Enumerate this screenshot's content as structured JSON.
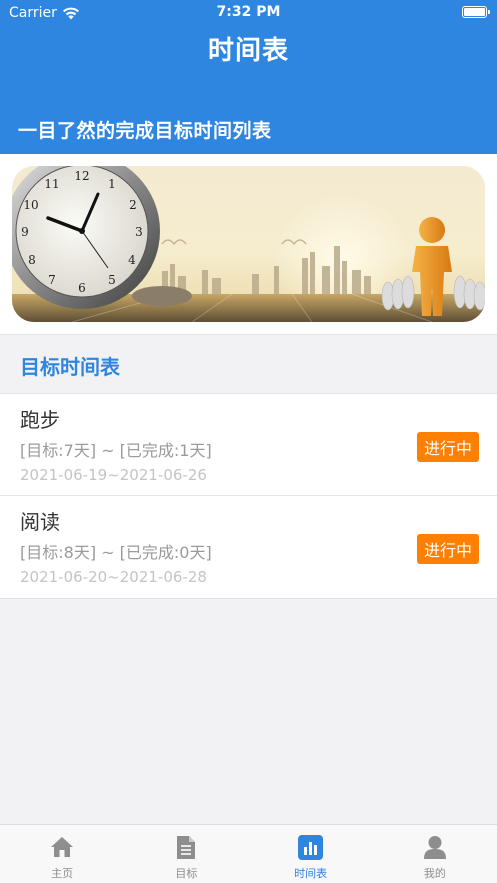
{
  "status_bar": {
    "carrier": "Carrier",
    "time": "7:32 PM"
  },
  "header": {
    "title": "时间表",
    "subtitle": "一目了然的完成目标时间列表"
  },
  "section": {
    "title": "目标时间表"
  },
  "goals": [
    {
      "name": "跑步",
      "detail": "[目标:7天] ~ [已完成:1天]",
      "dates": "2021-06-19~2021-06-26",
      "status": "进行中"
    },
    {
      "name": "阅读",
      "detail": "[目标:8天] ~ [已完成:0天]",
      "dates": "2021-06-20~2021-06-28",
      "status": "进行中"
    }
  ],
  "tabbar": {
    "items": [
      {
        "label": "主页",
        "icon": "home-icon"
      },
      {
        "label": "目标",
        "icon": "document-icon"
      },
      {
        "label": "时间表",
        "icon": "chart-icon"
      },
      {
        "label": "我的",
        "icon": "person-icon"
      }
    ],
    "active_index": 2
  },
  "colors": {
    "primary": "#2f86e0",
    "badge": "#ff7f00"
  }
}
